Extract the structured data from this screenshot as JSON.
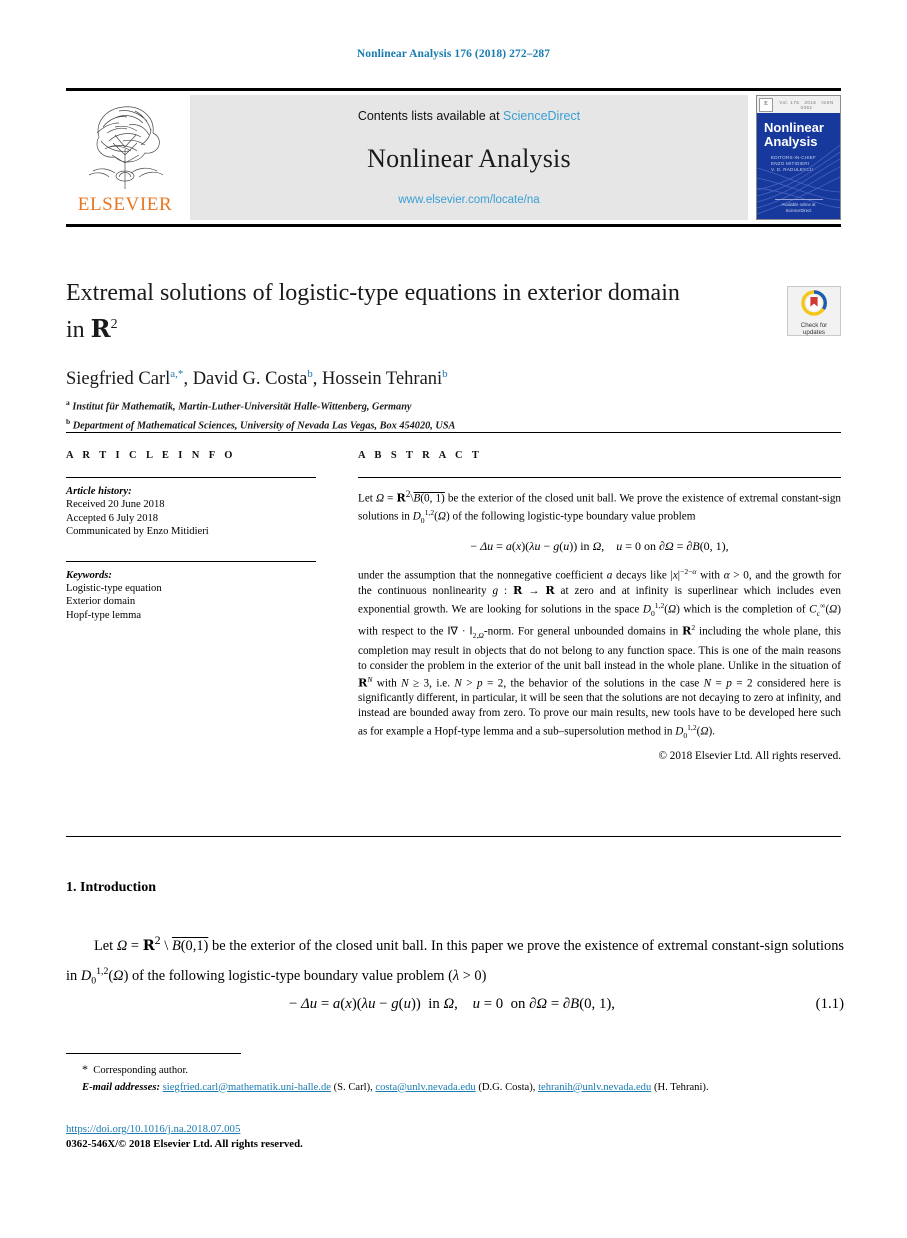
{
  "running_head": "Nonlinear Analysis 176 (2018) 272–287",
  "masthead": {
    "contents_prefix": "Contents lists available at ",
    "sciencedirect": "ScienceDirect",
    "journal_name": "Nonlinear Analysis",
    "journal_url": "www.elsevier.com/locate/na",
    "publisher": "ELSEVIER",
    "cover": {
      "title_line1": "Nonlinear",
      "title_line2": "Analysis",
      "sub_line1": "EDITORS-IN-CHIEF",
      "sub_line2": "ENZO MITIDIERI",
      "sub_line3": "V. D. RADULESCU",
      "foot_line1": "Available online at",
      "foot_line2": "ScienceDirect"
    }
  },
  "article": {
    "title_line1": "Extremal solutions of logistic-type equations in exterior domain",
    "title_line2_prefix": "in ",
    "title_line2_math": "R",
    "title_line2_sup": "2",
    "crossmark": {
      "label_line1": "Check for",
      "label_line2": "updates"
    },
    "authors": [
      {
        "name": "Siegfried Carl",
        "marks": "a,*"
      },
      {
        "name": "David G. Costa",
        "marks": "b"
      },
      {
        "name": "Hossein Tehrani",
        "marks": "b"
      }
    ],
    "affiliations": [
      {
        "mark": "a",
        "text": "Institut für Mathematik, Martin-Luther-Universität Halle-Wittenberg, Germany"
      },
      {
        "mark": "b",
        "text": "Department of Mathematical Sciences, University of Nevada Las Vegas, Box 454020, USA"
      }
    ]
  },
  "info": {
    "heading": "A R T I C L E   I N F O",
    "history_label": "Article history:",
    "history": [
      "Received 20 June 2018",
      "Accepted 6 July 2018",
      "Communicated by Enzo Mitidieri"
    ],
    "keywords_label": "Keywords:",
    "keywords": [
      "Logistic-type equation",
      "Exterior domain",
      "Hopf-type lemma"
    ]
  },
  "abstract": {
    "heading": "A B S T R A C T",
    "para1": "be the exterior of the closed unit ball. We prove the existence of extremal constant-sign solutions in",
    "para1_tail": "of the following logistic-type boundary value problem",
    "para2": "under the assumption that the nonnegative coefficient a decays like |x|−2−α with α > 0, and the growth for the continuous nonlinearity g : R → R at zero and at infinity is superlinear which includes even exponential growth. We are looking for solutions in the space D01,2(Ω) which is the completion of Cc∞(Ω) with respect to the ‖∇ · ‖2,Ω-norm. For general unbounded domains in R2 including the whole plane, this completion may result in objects that do not belong to any function space. This is one of the main reasons to consider the problem in the exterior of the unit ball instead in the whole plane. Unlike in the situation of RN with N ≥ 3, i.e. N > p = 2, the behavior of the solutions in the case N = p = 2 considered here is significantly different, in particular, it will be seen that the solutions are not decaying to zero at infinity, and instead are bounded away from zero. To prove our main results, new tools have to be developed here such as for example a Hopf-type lemma and a sub–supersolution method in D01,2(Ω).",
    "copyright": "© 2018 Elsevier Ltd. All rights reserved."
  },
  "body": {
    "section_title": "1. Introduction",
    "paragraph": "be the exterior of the closed unit ball. In this paper we prove the existence of extremal constant-sign solutions in",
    "paragraph_tail": "of the following logistic-type boundary value problem",
    "equation_number": "(1.1)"
  },
  "footnotes": {
    "corresponding": "Corresponding author.",
    "email_label": "E-mail addresses:",
    "emails": [
      {
        "address": "siegfried.carl@mathematik.uni-halle.de",
        "person": "(S. Carl),"
      },
      {
        "address": "costa@unlv.nevada.edu",
        "person": "(D.G. Costa),"
      },
      {
        "address": "tehranih@unlv.nevada.edu",
        "person": "(H. Tehrani)."
      }
    ],
    "doi": "https://doi.org/10.1016/j.na.2018.07.005",
    "issn": "0362-546X/© 2018 Elsevier Ltd. All rights reserved."
  },
  "colors": {
    "link": "#1a7bb0",
    "sciencedirect": "#3a9fd4",
    "elsevier_orange": "#e87722",
    "cover_blue": "#17389c"
  }
}
